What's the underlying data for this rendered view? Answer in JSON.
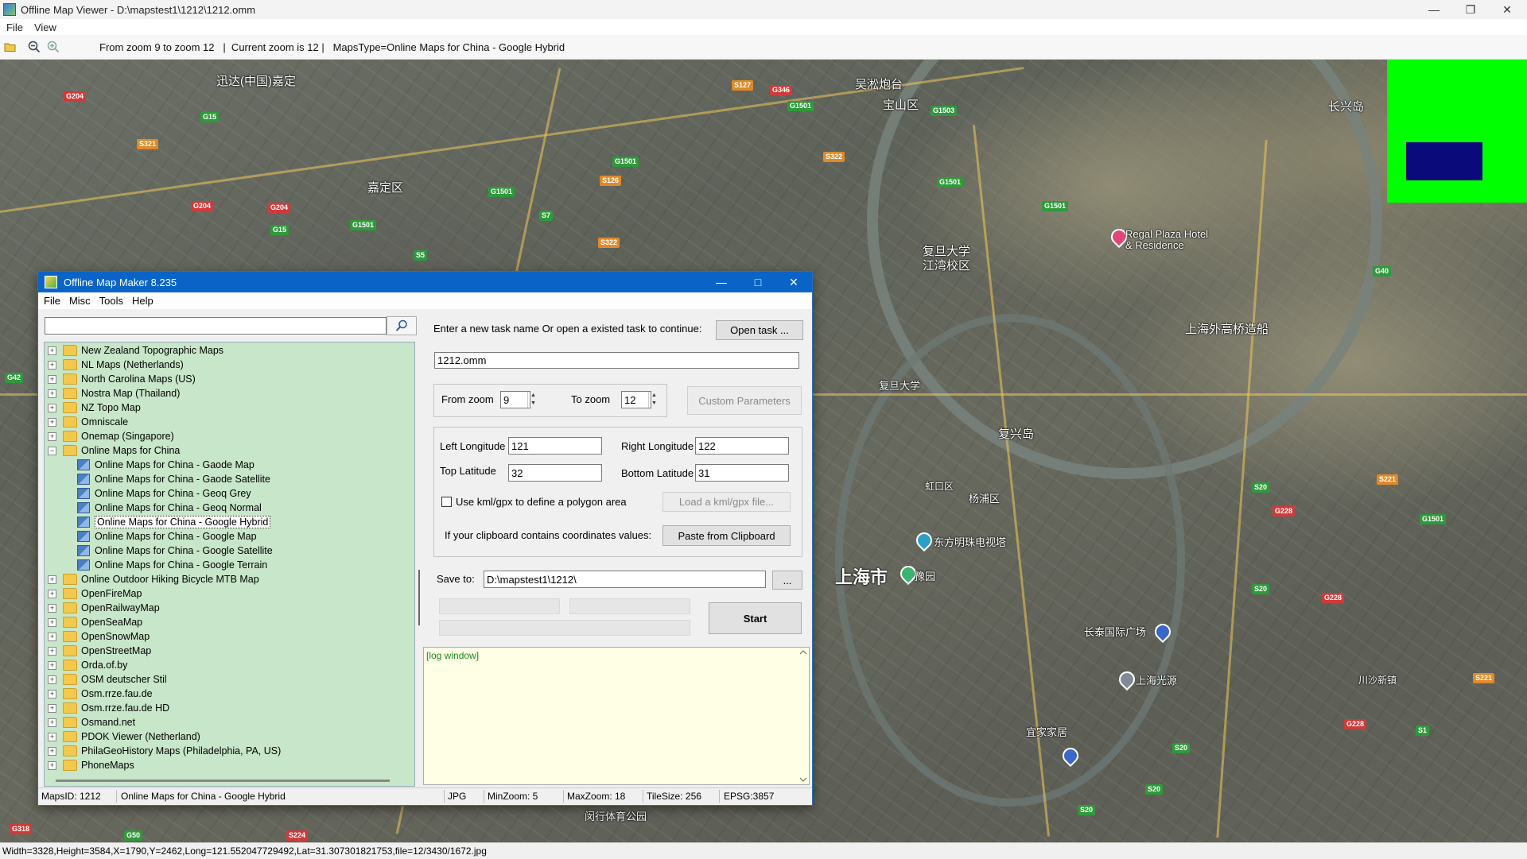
{
  "viewer": {
    "title": "Offline Map Viewer - D:\\mapstest1\\1212\\1212.omm",
    "menu": [
      "File",
      "View"
    ],
    "toolbar_info": "From zoom 9 to zoom 12   |  Current zoom is 12 |   MapsType=Online Maps for China - Google Hybrid",
    "status": "Width=3328,Height=3584,X=1790,Y=2462,Long=121.552047729492,Lat=31.307301821753,file=12/3430/1672.jpg",
    "icons": [
      "folder-open-icon",
      "zoom-out-icon",
      "zoom-in-icon"
    ]
  },
  "map": {
    "labels": {
      "xunxun": "迅达(中国)嘉定",
      "wusong": "吴淞炮台",
      "baoshan": "宝山区",
      "changxing": "长兴岛",
      "jiading": "嘉定区",
      "regal": "Regal Plaza Hotel",
      "regal2": "& Residence",
      "fudan_cj": "复旦大学",
      "fudan_cj2": "江湾校区",
      "pudong_bridge": "上海外高桥造船",
      "fudan": "复旦大学",
      "fuxing": "复兴岛",
      "yangpu": "杨浦区",
      "hongkou": "虹口区",
      "tower": "东方明珠电视塔",
      "shanghai": "上海市",
      "yuyuan": "豫园",
      "changtai": "长泰国际广场",
      "guangyuan": "上海光源",
      "chuansha": "川沙新镇",
      "ikea": "宜家家居",
      "minhang": "闵行体育公园"
    },
    "shields": [
      "G204",
      "G15",
      "S321",
      "G204",
      "G204",
      "G15",
      "G1501",
      "S5",
      "S7",
      "S322",
      "S127",
      "G346",
      "G1501",
      "G1503",
      "G1501",
      "S126",
      "G1501",
      "S322",
      "G1501",
      "G1501",
      "G42",
      "G40",
      "S20",
      "G228",
      "S20",
      "S221",
      "G1501",
      "G228",
      "S20",
      "S1",
      "G228",
      "S20",
      "S221",
      "G318",
      "G50",
      "S224",
      "S20"
    ],
    "overview_colors": {
      "bg": "#00ff00",
      "viewport": "#0a0a7a"
    }
  },
  "dialog": {
    "title": "Offline Map Maker 8.235",
    "menu": [
      "File",
      "Misc",
      "Tools",
      "Help"
    ],
    "search_value": "",
    "tree": [
      {
        "label": "New Zealand Topographic Maps",
        "type": "folder",
        "expander": "+"
      },
      {
        "label": "NL Maps (Netherlands)",
        "type": "folder",
        "expander": "+"
      },
      {
        "label": "North Carolina Maps (US)",
        "type": "folder",
        "expander": "+"
      },
      {
        "label": "Nostra Map (Thailand)",
        "type": "folder",
        "expander": "+"
      },
      {
        "label": "NZ Topo Map",
        "type": "folder",
        "expander": "+"
      },
      {
        "label": "Omniscale",
        "type": "folder",
        "expander": "+"
      },
      {
        "label": "Onemap (Singapore)",
        "type": "folder",
        "expander": "+"
      },
      {
        "label": "Online Maps for China",
        "type": "folder-open",
        "expander": "−"
      },
      {
        "label": "Online Maps for China - Gaode Map",
        "type": "map"
      },
      {
        "label": "Online Maps for China - Gaode Satellite",
        "type": "map"
      },
      {
        "label": "Online Maps for China - Geoq Grey",
        "type": "map"
      },
      {
        "label": "Online Maps for China - Geoq Normal",
        "type": "map"
      },
      {
        "label": "Online Maps for China - Google Hybrid",
        "type": "map",
        "selected": true
      },
      {
        "label": "Online Maps for China - Google Map",
        "type": "map"
      },
      {
        "label": "Online Maps for China - Google Satellite",
        "type": "map"
      },
      {
        "label": "Online Maps for China - Google Terrain",
        "type": "map"
      },
      {
        "label": "Online Outdoor Hiking Bicycle MTB Map",
        "type": "folder",
        "expander": "+"
      },
      {
        "label": "OpenFireMap",
        "type": "folder",
        "expander": "+"
      },
      {
        "label": "OpenRailwayMap",
        "type": "folder",
        "expander": "+"
      },
      {
        "label": "OpenSeaMap",
        "type": "folder",
        "expander": "+"
      },
      {
        "label": "OpenSnowMap",
        "type": "folder",
        "expander": "+"
      },
      {
        "label": "OpenStreetMap",
        "type": "folder",
        "expander": "+"
      },
      {
        "label": "Orda.of.by",
        "type": "folder",
        "expander": "+"
      },
      {
        "label": "OSM deutscher Stil",
        "type": "folder",
        "expander": "+"
      },
      {
        "label": "Osm.rrze.fau.de",
        "type": "folder",
        "expander": "+"
      },
      {
        "label": "Osm.rrze.fau.de HD",
        "type": "folder",
        "expander": "+"
      },
      {
        "label": "Osmand.net",
        "type": "folder",
        "expander": "+"
      },
      {
        "label": "PDOK Viewer (Netherland)",
        "type": "folder",
        "expander": "+"
      },
      {
        "label": "PhilaGeoHistory Maps (Philadelphia, PA, US)",
        "type": "folder",
        "expander": "+"
      },
      {
        "label": "PhoneMaps",
        "type": "folder",
        "expander": "+"
      }
    ],
    "task_prompt": "Enter a new task name Or open a existed task to continue:",
    "open_task": "Open task ...",
    "task_name": "1212.omm",
    "from_zoom_label": "From zoom",
    "from_zoom": "9",
    "to_zoom_label": "To zoom",
    "to_zoom": "12",
    "custom_params": "Custom Parameters",
    "left_lon_label": "Left Longitude",
    "left_lon": "121",
    "right_lon_label": "Right Longitude",
    "right_lon": "122",
    "top_lat_label": "Top Latitude",
    "top_lat": "32",
    "bottom_lat_label": "Bottom Latitude",
    "bottom_lat": "31",
    "kml_label": "Use kml/gpx to define a polygon area",
    "kml_button": "Load a kml/gpx file...",
    "clipboard_label": "If your clipboard contains coordinates values:",
    "clipboard_button": "Paste from Clipboard",
    "save_label": "Save to:",
    "save_path": "D:\\mapstest1\\1212\\",
    "browse": "...",
    "start": "Start",
    "log": "[log window]",
    "status": {
      "maps_id": "MapsID: 1212",
      "maps_type": "Online Maps for China - Google Hybrid",
      "format": "JPG",
      "min_zoom": "MinZoom: 5",
      "max_zoom": "MaxZoom: 18",
      "tile_size": "TileSize: 256",
      "epsg": "EPSG:3857"
    }
  }
}
